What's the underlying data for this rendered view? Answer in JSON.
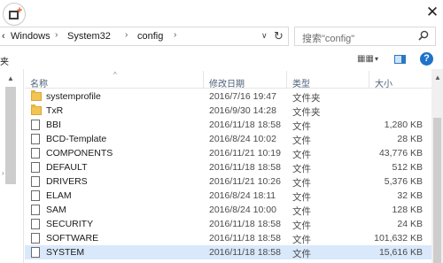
{
  "window": {
    "app_icon": "folder-plus-icon",
    "close_label": "✕"
  },
  "address": {
    "back_chevron": "‹",
    "crumbs": [
      "Windows",
      "System32",
      "config"
    ],
    "separator": "›",
    "dropdown": "∨",
    "refresh": "↻"
  },
  "search": {
    "placeholder": "搜索\"config\"",
    "icon": "search-icon"
  },
  "toolbar": {
    "left_fragment": "夹",
    "view_label": "▦▦",
    "view_drop": "▾",
    "help_label": "?"
  },
  "columns": {
    "name": "名称",
    "date": "修改日期",
    "type": "类型",
    "size": "大小",
    "sort_caret": "^"
  },
  "files": [
    {
      "name": "systemprofile",
      "date": "2016/7/16 19:47",
      "type": "文件夹",
      "size": "",
      "kind": "folder"
    },
    {
      "name": "TxR",
      "date": "2016/9/30 14:28",
      "type": "文件夹",
      "size": "",
      "kind": "folder"
    },
    {
      "name": "BBI",
      "date": "2016/11/18 18:58",
      "type": "文件",
      "size": "1,280 KB",
      "kind": "file"
    },
    {
      "name": "BCD-Template",
      "date": "2016/8/24 10:02",
      "type": "文件",
      "size": "28 KB",
      "kind": "file"
    },
    {
      "name": "COMPONENTS",
      "date": "2016/11/21 10:19",
      "type": "文件",
      "size": "43,776 KB",
      "kind": "file"
    },
    {
      "name": "DEFAULT",
      "date": "2016/11/18 18:58",
      "type": "文件",
      "size": "512 KB",
      "kind": "file"
    },
    {
      "name": "DRIVERS",
      "date": "2016/11/21 10:26",
      "type": "文件",
      "size": "5,376 KB",
      "kind": "file"
    },
    {
      "name": "ELAM",
      "date": "2016/8/24 18:11",
      "type": "文件",
      "size": "32 KB",
      "kind": "file"
    },
    {
      "name": "SAM",
      "date": "2016/8/24 10:00",
      "type": "文件",
      "size": "128 KB",
      "kind": "file"
    },
    {
      "name": "SECURITY",
      "date": "2016/11/18 18:58",
      "type": "文件",
      "size": "24 KB",
      "kind": "file"
    },
    {
      "name": "SOFTWARE",
      "date": "2016/11/18 18:58",
      "type": "文件",
      "size": "101,632 KB",
      "kind": "file"
    },
    {
      "name": "SYSTEM",
      "date": "2016/11/18 18:58",
      "type": "文件",
      "size": "15,616 KB",
      "kind": "file",
      "selected": true
    }
  ],
  "colors": {
    "selection": "#d9e8fb",
    "folder": "#f2c452",
    "header_text": "#4c607a",
    "help_button": "#1e73c8"
  }
}
